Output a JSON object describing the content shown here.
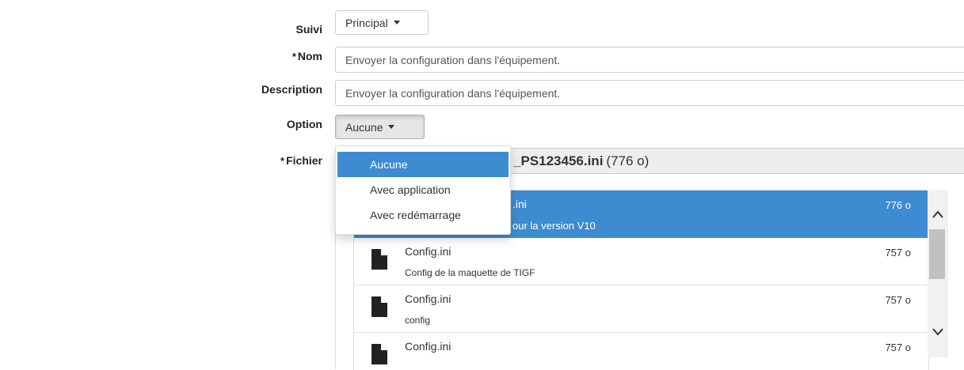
{
  "form": {
    "suivi": {
      "label": "Suivi",
      "value": "Principal"
    },
    "nom": {
      "required_mark": "*",
      "label": "Nom",
      "value": "Envoyer la configuration dans l'équipement."
    },
    "description": {
      "label": "Description",
      "value": "Envoyer la configuration dans l'équipement."
    },
    "option": {
      "label": "Option",
      "value": "Aucune"
    },
    "fichier": {
      "required_mark": "*",
      "label": "Fichier",
      "selected_name_visible": "_PS123456.ini",
      "selected_size": "(776 o)"
    }
  },
  "option_menu": {
    "items": [
      {
        "label": "Aucune",
        "active": true
      },
      {
        "label": "Avec application",
        "active": false
      },
      {
        "label": "Avec redémarrage",
        "active": false
      }
    ]
  },
  "file_list": {
    "rows": [
      {
        "name_visible": ".ini",
        "desc_visible": "our la version V10",
        "size": "776 o",
        "selected": true
      },
      {
        "name": "Config.ini",
        "desc": "Config de la maquette de TIGF",
        "size": "757 o",
        "selected": false
      },
      {
        "name": "Config.ini",
        "desc": "config",
        "size": "757 o",
        "selected": false
      },
      {
        "name": "Config.ini",
        "desc": "",
        "size": "757 o",
        "selected": false
      }
    ]
  },
  "colors": {
    "accent": "#3d8bd1",
    "border": "#cccccc",
    "readonly_bg": "#eeeeee"
  },
  "icons": {
    "file": "file-icon",
    "caret": "caret-down-icon",
    "scroll_up": "chevron-up-icon",
    "scroll_down": "chevron-down-icon"
  }
}
